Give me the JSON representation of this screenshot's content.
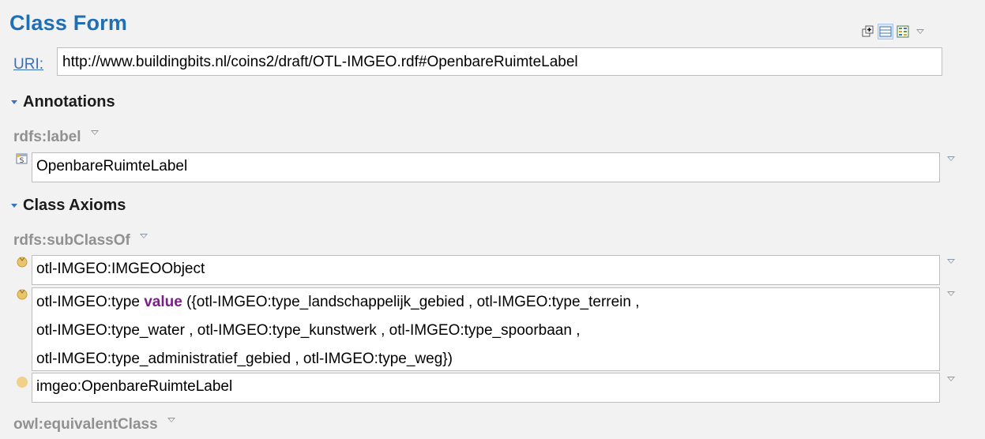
{
  "form": {
    "title": "Class Form",
    "uri_label": "URI:",
    "uri_value": "http://www.buildingbits.nl/coins2/draft/OTL-IMGEO.rdf#OpenbareRuimteLabel"
  },
  "toolbar": {
    "icons": [
      "add-widget-icon",
      "single-column-layout-icon",
      "grid-layout-icon",
      "view-menu-icon"
    ]
  },
  "annotations": {
    "section_label": "Annotations",
    "property_label": "rdfs:label",
    "label_value": "OpenbareRuimteLabel"
  },
  "class_axioms": {
    "section_label": "Class Axioms",
    "subclass_label": "rdfs:subClassOf",
    "items": [
      {
        "text": "otl-IMGEO:IMGEOObject"
      },
      {
        "prefix": "otl-IMGEO:type",
        "keyword": "value",
        "line1_rest": "({otl-IMGEO:type_landschappelijk_gebied , otl-IMGEO:type_terrein ,",
        "line2": "otl-IMGEO:type_water , otl-IMGEO:type_kunstwerk , otl-IMGEO:type_spoorbaan ,",
        "line3": "otl-IMGEO:type_administratief_gebied , otl-IMGEO:type_weg})"
      },
      {
        "text": "imgeo:OpenbareRuimteLabel"
      }
    ],
    "equivalent_label": "owl:equivalentClass"
  },
  "colors": {
    "title": "#1f6fb5",
    "link": "#3a6fb7",
    "keyword": "#7a1f87",
    "property_label": "#909090",
    "class_icon": "#e9c46a"
  }
}
